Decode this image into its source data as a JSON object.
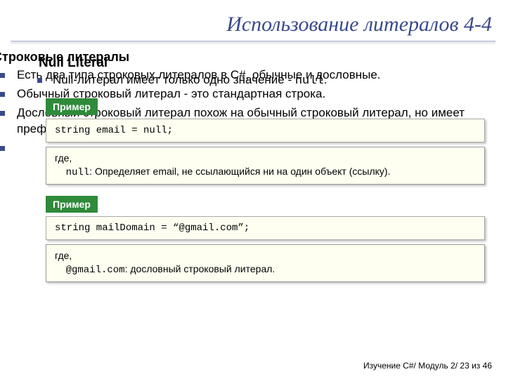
{
  "title": "Использование литералов 4-4",
  "layer1": {
    "section_title": "Строковые литералы",
    "bullets": [
      "Есть два типа строковых литералов в C#, обычные и дословные.",
      "Обычный строковый литерал - это стандартная строка.",
      "Дословный строковый литерал похож на обычный строковый литерал, но имеет префикс @.",
      ""
    ]
  },
  "layer2": {
    "sub_title": "Null Literal",
    "bullet_prefix": "Null-литерал имеет только одно значение - ",
    "null_word": "null",
    "dot": ".",
    "example_label": "Пример",
    "code1": "string email = null;",
    "expl1_where": "где,",
    "expl1_indent": "    ",
    "expl1_code": "null",
    "expl1_text": ": Определяет email, не ссылающийся ни на один объект (ссылку).",
    "code2": "string mailDomain = “@gmail.com”;",
    "expl2_where": "где,",
    "expl2_indent": "    ",
    "expl2_code": "@gmail.com",
    "expl2_text": ": дословный строковый литерал."
  },
  "footer": "Изучение C#/ Модуль 2/ 23 из 46"
}
